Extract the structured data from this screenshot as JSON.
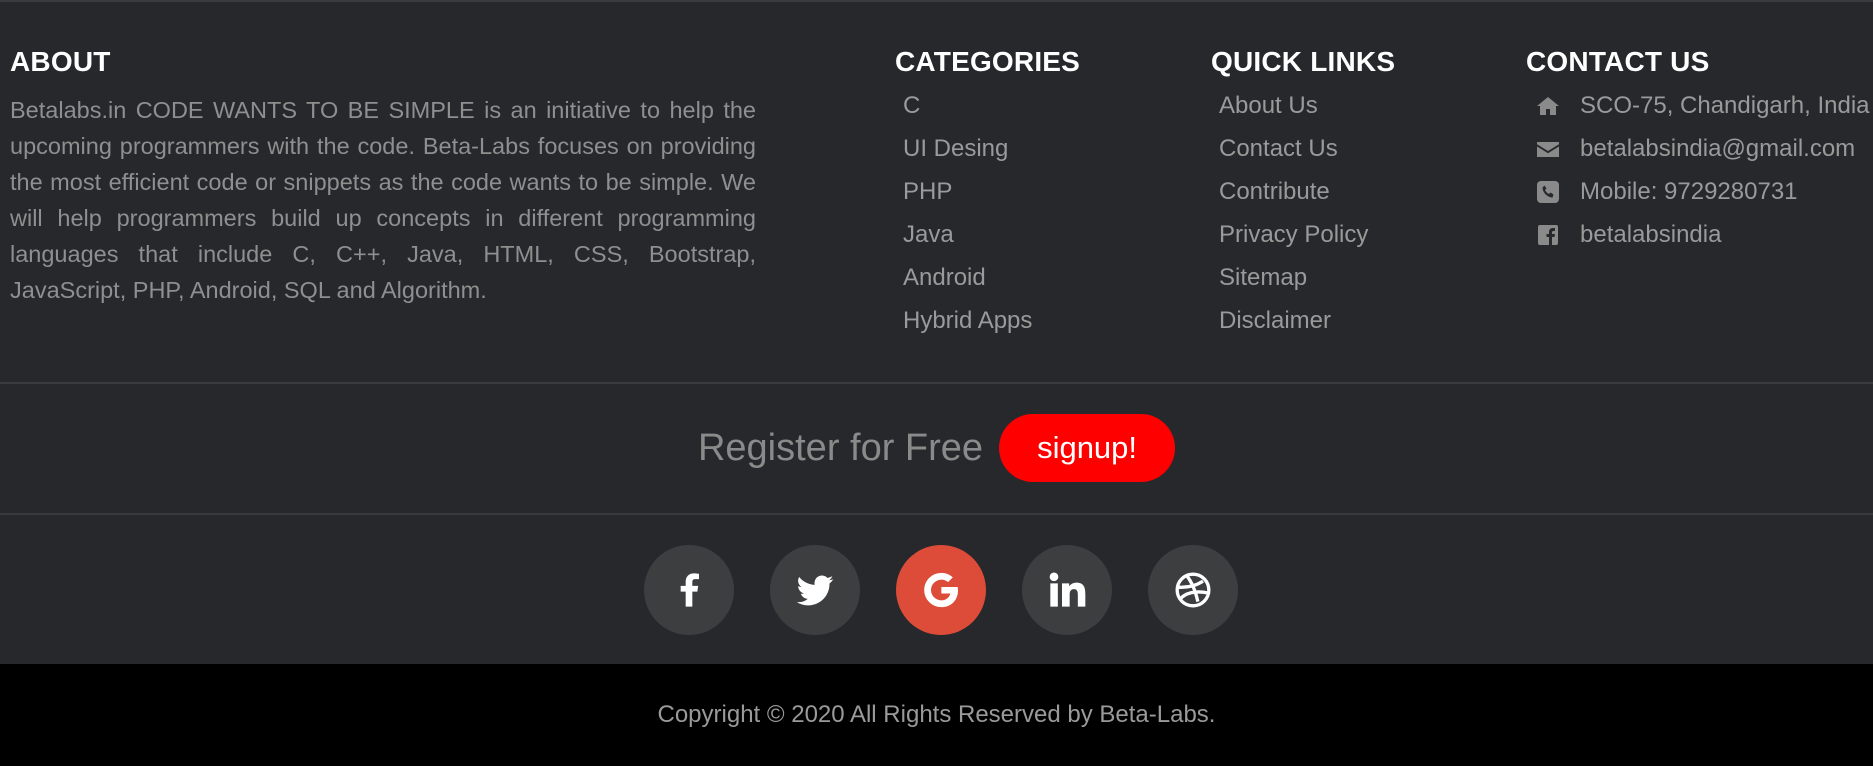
{
  "about": {
    "title": "ABOUT",
    "text": "Betalabs.in CODE WANTS TO BE SIMPLE is an initiative to help the upcoming programmers with the code. Beta-Labs focuses on providing the most efficient code or snippets as the code wants to be simple. We will help programmers build up concepts in different programming languages that include C, C++, Java, HTML, CSS, Bootstrap, JavaScript, PHP, Android, SQL and Algorithm."
  },
  "categories": {
    "title": "CATEGORIES",
    "items": [
      "C",
      "UI Desing",
      "PHP",
      "Java",
      "Android",
      "Hybrid Apps"
    ]
  },
  "quick_links": {
    "title": "QUICK LINKS",
    "items": [
      "About Us",
      "Contact Us",
      "Contribute",
      "Privacy Policy",
      "Sitemap",
      "Disclaimer"
    ]
  },
  "contact": {
    "title": "CONTACT US",
    "items": [
      {
        "icon": "home-icon",
        "text": "SCO-75, Chandigarh, India"
      },
      {
        "icon": "envelope-icon",
        "text": "betalabsindia@gmail.com"
      },
      {
        "icon": "phone-icon",
        "text": "Mobile: 9729280731"
      },
      {
        "icon": "facebook-square-icon",
        "text": "betalabsindia"
      }
    ]
  },
  "register": {
    "text": "Register for Free",
    "button": "signup!"
  },
  "social": [
    "facebook-icon",
    "twitter-icon",
    "google-icon",
    "linkedin-icon",
    "dribbble-icon"
  ],
  "colors": {
    "background": "#27282c",
    "signup": "#ff0000",
    "google": "#dd4b39",
    "social_bg": "#3d3e40"
  },
  "copyright": "Copyright © 2020 All Rights Reserved by Beta-Labs."
}
